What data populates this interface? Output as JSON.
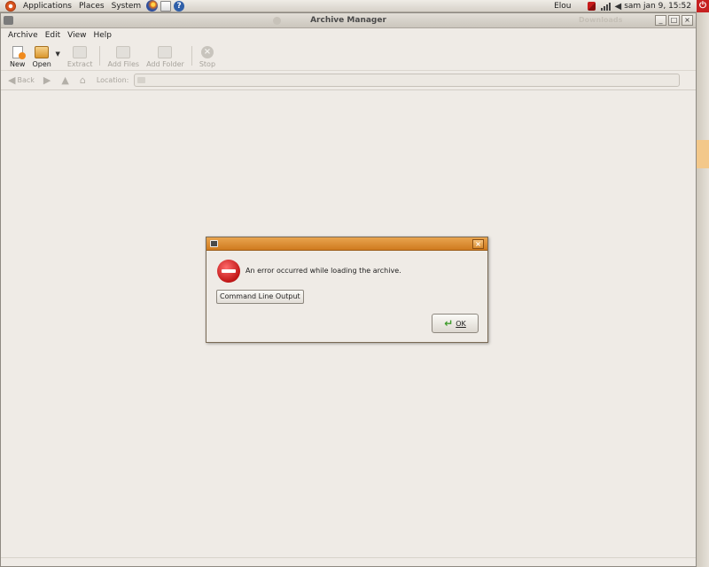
{
  "panel": {
    "menus": [
      "Applications",
      "Places",
      "System"
    ],
    "user": "Elou",
    "clock": "sam jan  9, 15:52"
  },
  "window": {
    "title": "Archive Manager",
    "background_title": "Downloads",
    "controls": {
      "minimize": "_",
      "maximize": "□",
      "close": "×"
    }
  },
  "menubar": [
    "Archive",
    "Edit",
    "View",
    "Help"
  ],
  "toolbar": {
    "new": "New",
    "open": "Open",
    "extract": "Extract",
    "add_files": "Add Files",
    "add_folder": "Add Folder",
    "stop": "Stop"
  },
  "locationbar": {
    "back": "Back",
    "location_label": "Location:",
    "location_value": ""
  },
  "dialog": {
    "message": "An error occurred while loading the archive.",
    "command_line_button": "Command Line Output",
    "ok_button": "OK",
    "close": "×"
  },
  "colors": {
    "panel_bg": "#e4e0d9",
    "window_bg": "#efebe6",
    "dialog_titlebar": "#d98b2e",
    "error_red": "#c01616",
    "ok_green": "#3f9b2c"
  },
  "icons": {
    "panel": [
      "ubuntu-logo-icon",
      "firefox-icon",
      "mail-icon",
      "help-icon",
      "network-icon",
      "signal-icon",
      "volume-icon",
      "power-icon"
    ],
    "toolbar": [
      "new-archive-icon",
      "open-folder-icon",
      "extract-icon",
      "add-files-icon",
      "add-folder-icon",
      "stop-icon"
    ],
    "dialog": [
      "error-icon",
      "ok-check-icon"
    ]
  }
}
